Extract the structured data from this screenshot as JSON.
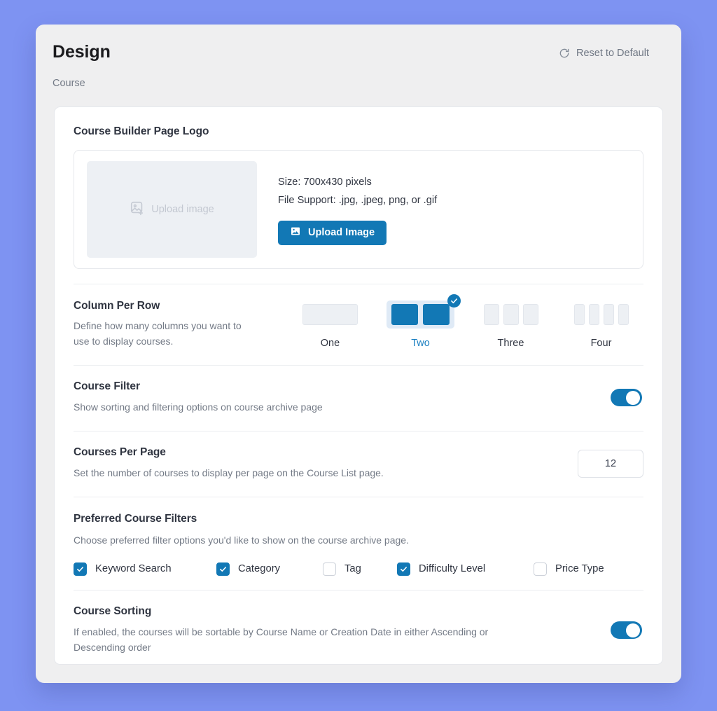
{
  "header": {
    "title": "Design",
    "breadcrumb": "Course",
    "reset_label": "Reset to Default",
    "reset_icon": "refresh-cw-icon"
  },
  "logo_section": {
    "title": "Course Builder Page Logo",
    "placeholder_label": "Upload image",
    "placeholder_icon": "image-add-icon",
    "size_line": "Size: 700x430 pixels",
    "support_line": "File Support: .jpg, .jpeg, png, or .gif",
    "upload_button_label": "Upload Image",
    "upload_button_icon": "image-icon"
  },
  "column_per_row": {
    "title": "Column Per Row",
    "description": "Define how many columns you want to use to display courses.",
    "selected": "Two",
    "options": [
      {
        "label": "One",
        "cells": 1,
        "selected": false
      },
      {
        "label": "Two",
        "cells": 2,
        "selected": true
      },
      {
        "label": "Three",
        "cells": 3,
        "selected": false
      },
      {
        "label": "Four",
        "cells": 4,
        "selected": false
      }
    ]
  },
  "course_filter": {
    "title": "Course Filter",
    "description": "Show sorting and filtering options on course archive page",
    "enabled": true
  },
  "courses_per_page": {
    "title": "Courses Per Page",
    "description": "Set the number of courses to display per page on the Course List page.",
    "value": "12"
  },
  "preferred_filters": {
    "title": "Preferred Course Filters",
    "description": "Choose preferred filter options you'd like to show on the course archive page.",
    "items": [
      {
        "label": "Keyword Search",
        "checked": true
      },
      {
        "label": "Category",
        "checked": true
      },
      {
        "label": "Tag",
        "checked": false
      },
      {
        "label": "Difficulty Level",
        "checked": true
      },
      {
        "label": "Price Type",
        "checked": false
      }
    ]
  },
  "course_sorting": {
    "title": "Course Sorting",
    "description": "If enabled, the courses will be sortable by Course Name or Creation Date in either Ascending or Descending order",
    "enabled": true
  },
  "colors": {
    "accent": "#1278b5",
    "page_background": "#7e93f2",
    "window_background": "#efeff0",
    "panel_background": "#ffffff"
  }
}
